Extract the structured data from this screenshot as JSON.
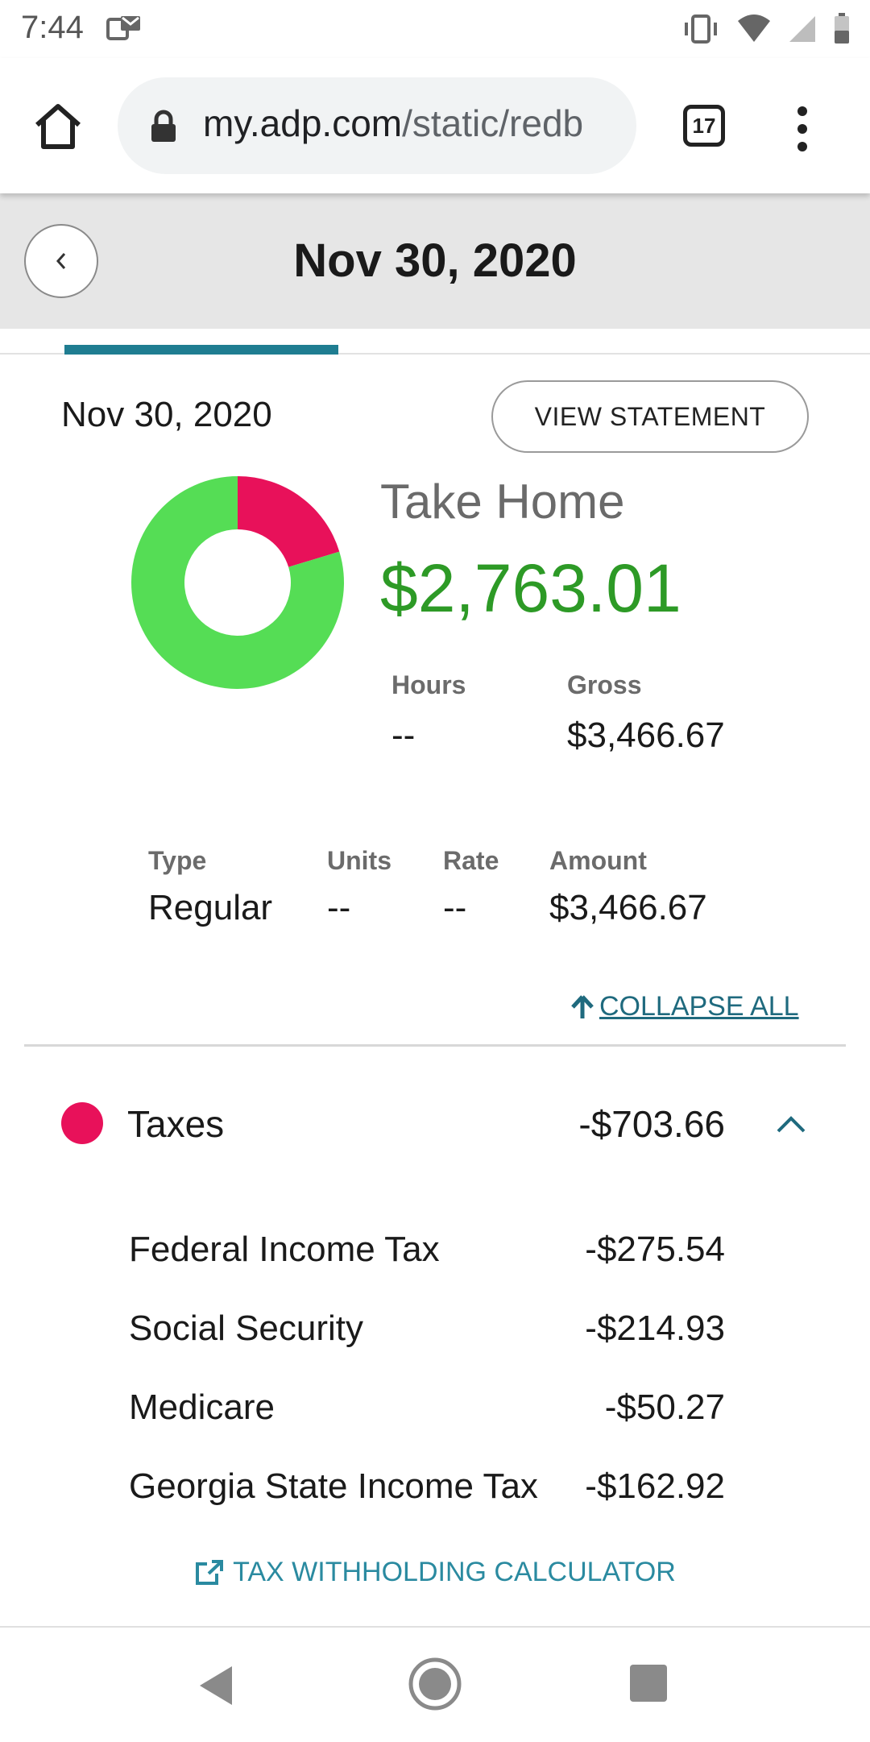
{
  "status_bar": {
    "time": "7:44"
  },
  "browser": {
    "url_domain": "my.adp.com",
    "url_path": "/static/redb",
    "tab_count": "17"
  },
  "header": {
    "title": "Nov 30, 2020"
  },
  "statement": {
    "date": "Nov 30, 2020",
    "view_button": "VIEW STATEMENT",
    "take_home_label": "Take Home",
    "take_home_amount": "$2,763.01",
    "hours_label": "Hours",
    "hours_value": "--",
    "gross_label": "Gross",
    "gross_value": "$3,466.67"
  },
  "donut": {
    "segments": [
      {
        "name": "Taxes",
        "value": 703.66,
        "color": "#e8115a"
      },
      {
        "name": "Take Home",
        "value": 2763.01,
        "color": "#55dd55"
      }
    ]
  },
  "earnings": {
    "headers": {
      "type": "Type",
      "units": "Units",
      "rate": "Rate",
      "amount": "Amount"
    },
    "row": {
      "type": "Regular",
      "units": "--",
      "rate": "--",
      "amount": "$3,466.67"
    }
  },
  "collapse_all": "COLLAPSE ALL",
  "taxes": {
    "label": "Taxes",
    "amount": "-$703.66",
    "color": "#e8115a",
    "items": [
      {
        "name": "Federal Income Tax",
        "amount": "-$275.54"
      },
      {
        "name": "Social Security",
        "amount": "-$214.93"
      },
      {
        "name": "Medicare",
        "amount": "-$50.27"
      },
      {
        "name": "Georgia State Income Tax",
        "amount": "-$162.92"
      }
    ]
  },
  "calculator_link": "TAX WITHHOLDING CALCULATOR",
  "colors": {
    "accent": "#1f7d91",
    "take_home_green": "#2d9a26",
    "link": "#2a8aa0"
  }
}
